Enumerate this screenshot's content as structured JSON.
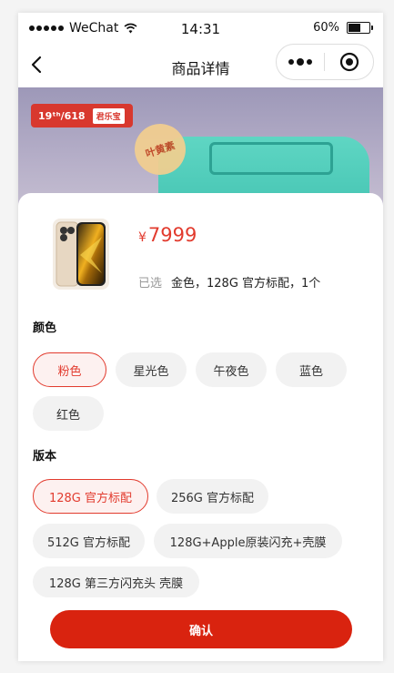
{
  "status_bar": {
    "carrier": "WeChat",
    "time": "14:31",
    "battery_percent": "60%",
    "battery_level": 0.6
  },
  "nav": {
    "title": "商品详情",
    "back_icon": "chevron-left-icon",
    "more_icon": "more-dots-icon",
    "close_icon": "target-icon"
  },
  "banner": {
    "promo_text": "19ᵗʰ/618",
    "promo_logo": "君乐宝",
    "sticker_text": "叶黄素"
  },
  "product": {
    "price_symbol": "¥",
    "price": "7999",
    "selected_label": "已选",
    "selected_value": "金色，128G 官方标配，1个"
  },
  "sections": {
    "color": {
      "title": "颜色",
      "options": [
        "粉色",
        "星光色",
        "午夜色",
        "蓝色",
        "红色"
      ],
      "selected_index": 0
    },
    "version": {
      "title": "版本",
      "options": [
        "128G 官方标配",
        "256G 官方标配",
        "512G 官方标配",
        "128G+Apple原装闪充+壳膜",
        "128G 第三方闪充头 壳膜"
      ],
      "selected_index": 0
    }
  },
  "confirm_button": {
    "label": "确认"
  },
  "colors": {
    "accent": "#e23b2e",
    "confirm": "#d9230f",
    "chip_bg": "#f2f2f2"
  }
}
